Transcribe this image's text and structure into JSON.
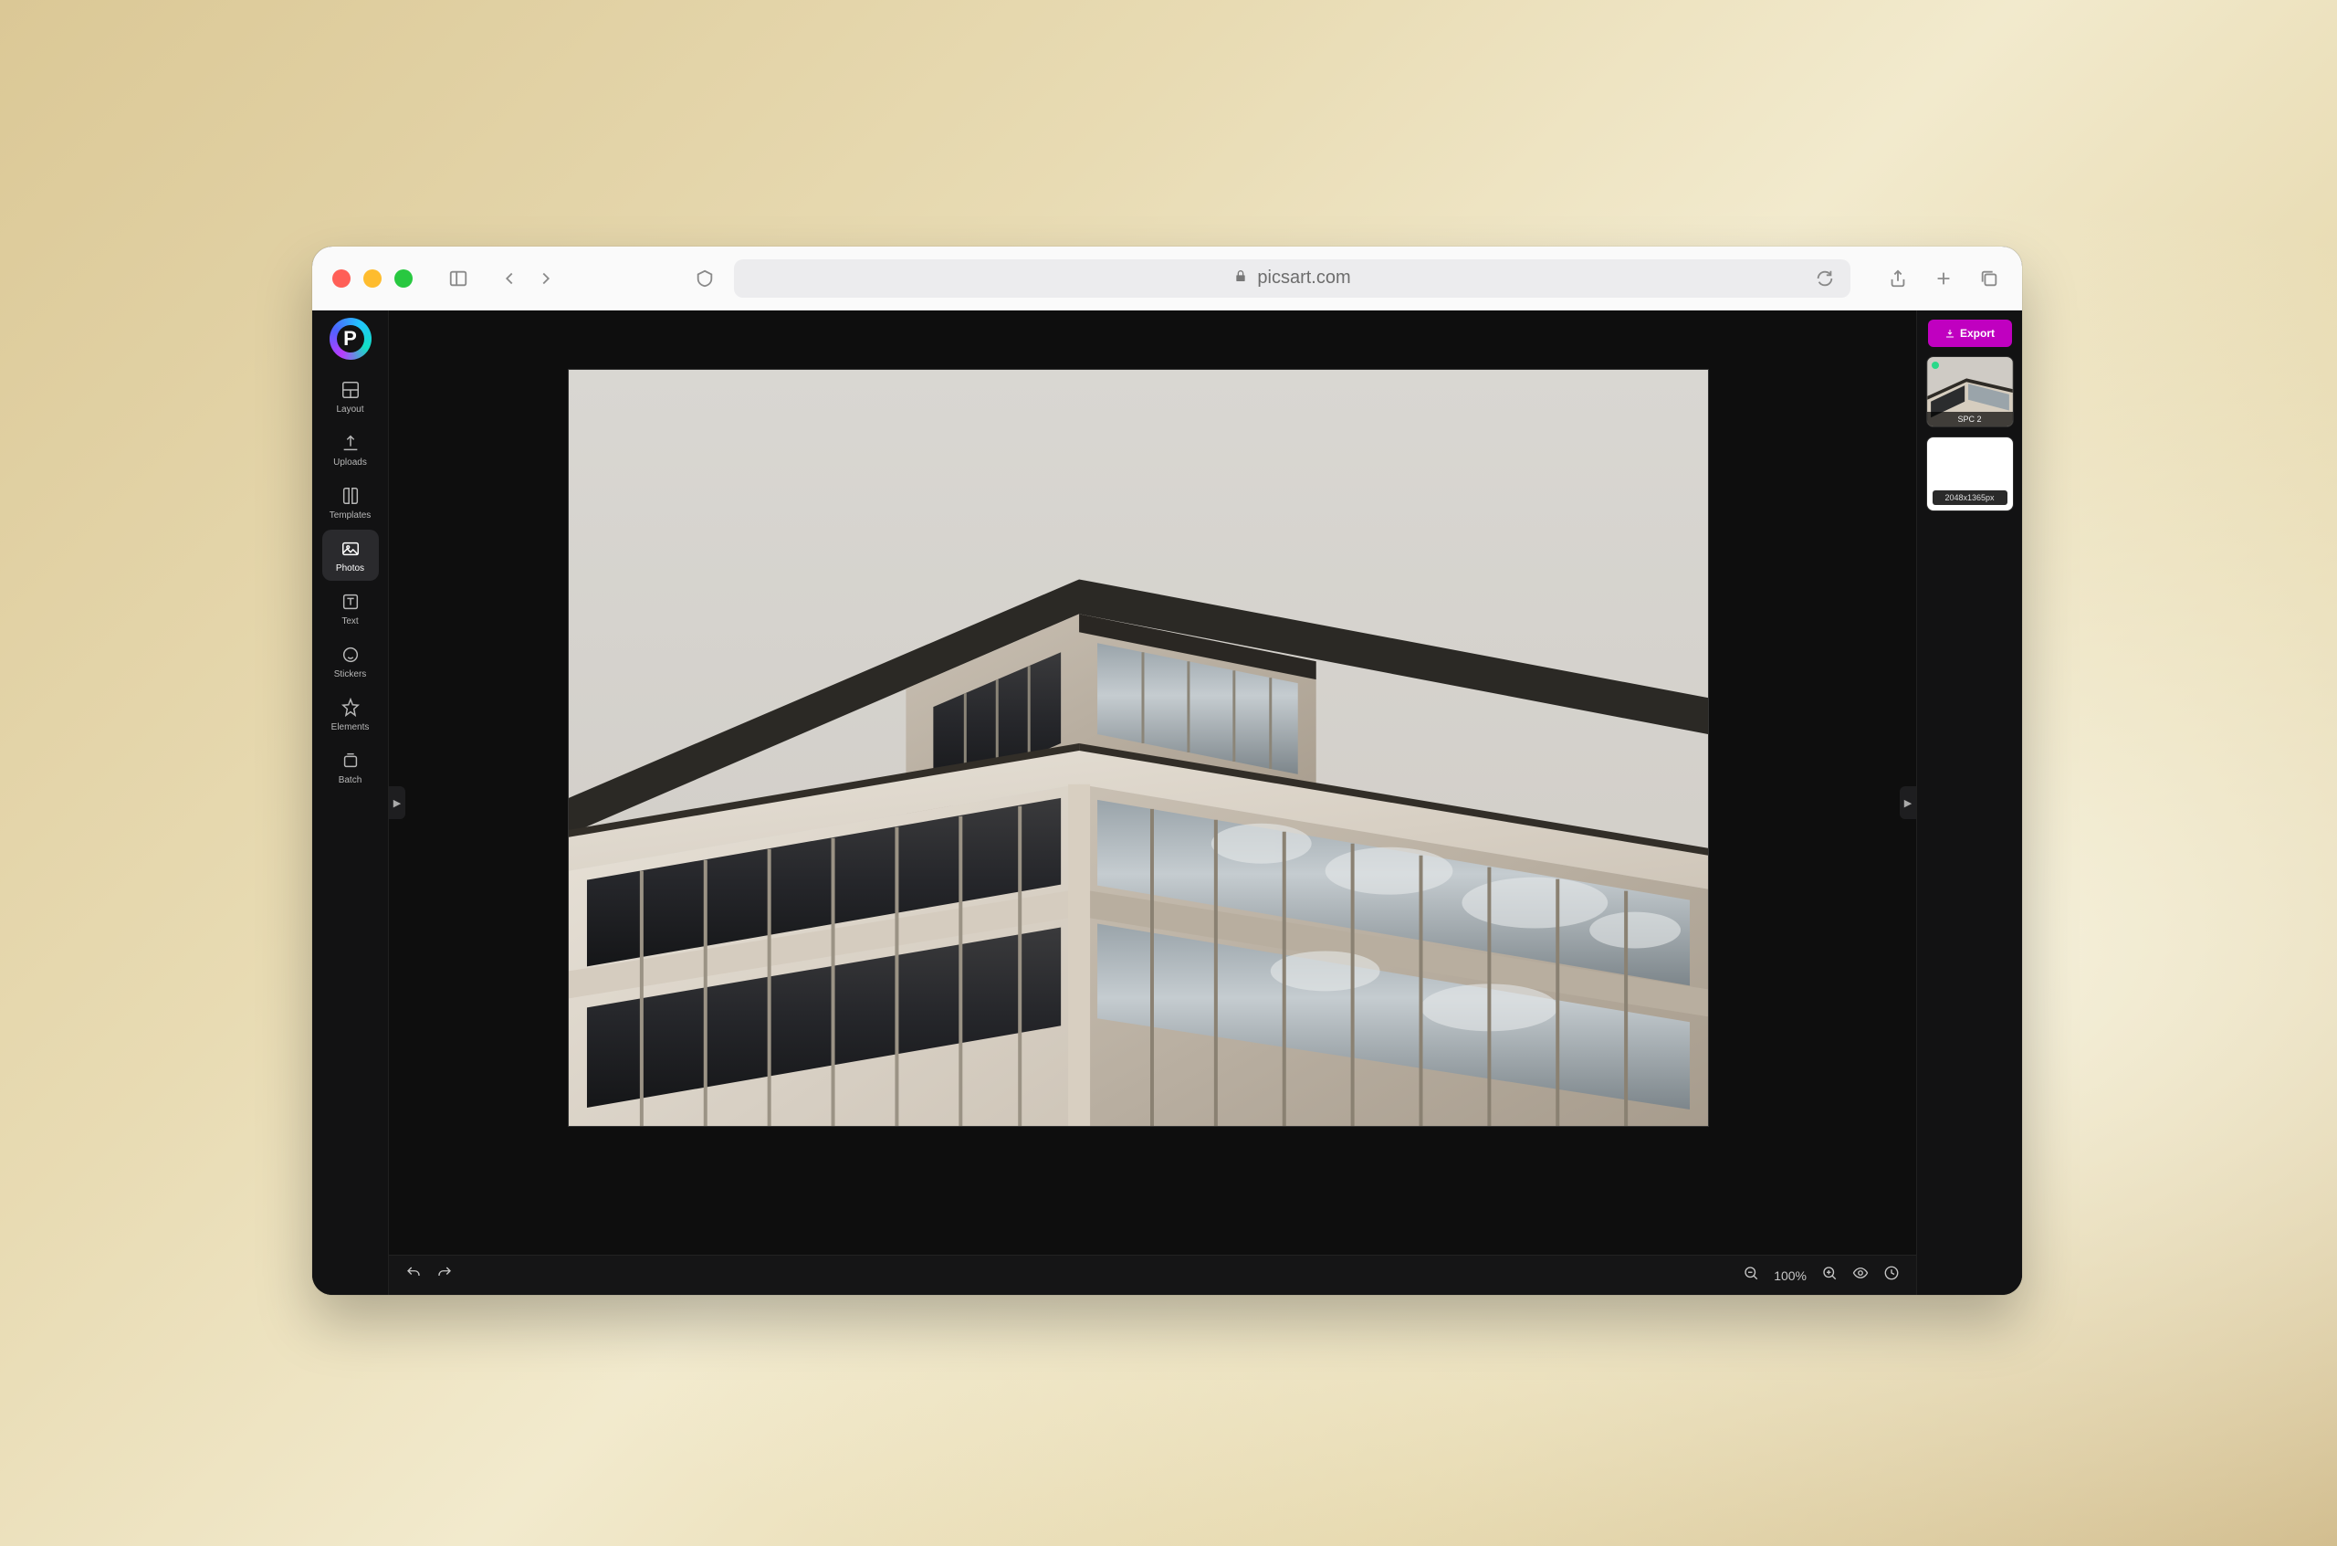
{
  "browser": {
    "url": "picsart.com"
  },
  "sidebar": {
    "items": [
      {
        "label": "Layout"
      },
      {
        "label": "Uploads"
      },
      {
        "label": "Templates"
      },
      {
        "label": "Photos"
      },
      {
        "label": "Text"
      },
      {
        "label": "Stickers"
      },
      {
        "label": "Elements"
      },
      {
        "label": "Batch"
      }
    ],
    "active_index": 3
  },
  "toolbar": {
    "export_label": "Export"
  },
  "right_panel": {
    "pages": [
      {
        "label": "SPC 2"
      },
      {
        "dimensions": "2048x1365px"
      }
    ]
  },
  "bottom_bar": {
    "zoom": "100%"
  }
}
